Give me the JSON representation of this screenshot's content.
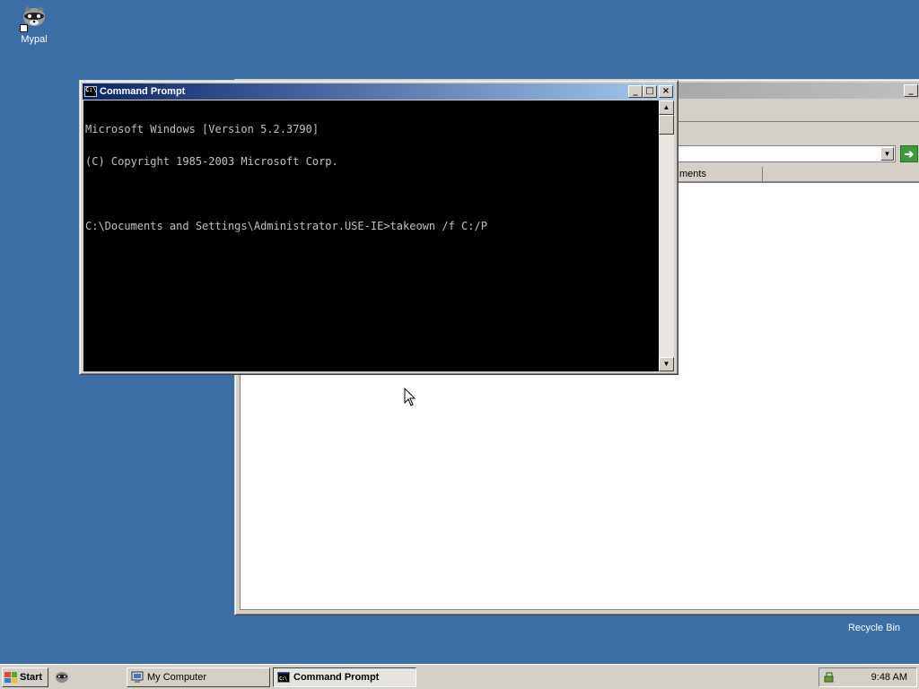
{
  "desktop": {
    "icons": [
      {
        "label": "Mypal",
        "icon": "mypal-raccoon-icon"
      },
      {
        "label": "Recycle Bin",
        "icon": "recycle-bin-icon"
      }
    ]
  },
  "explorer_window": {
    "column_header_partial": "ments",
    "go_icon": "go-arrow-icon"
  },
  "cmd_window": {
    "title": "Command Prompt",
    "lines": [
      "Microsoft Windows [Version 5.2.3790]",
      "(C) Copyright 1985-2003 Microsoft Corp.",
      "",
      "C:\\Documents and Settings\\Administrator.USE-IE>takeown /f C:/P"
    ],
    "buttons": {
      "minimize": "_",
      "maximize": "□",
      "close": "×"
    }
  },
  "taskbar": {
    "start_label": "Start",
    "tasks": [
      {
        "label": "My Computer",
        "icon": "my-computer-icon",
        "active": false
      },
      {
        "label": "Command Prompt",
        "icon": "cmd-icon",
        "active": true
      }
    ],
    "clock": "9:48 AM"
  },
  "colors": {
    "desktop": "#3a6ea5",
    "title_active_start": "#0a246a",
    "title_active_end": "#a6caf0",
    "console_bg": "#000000",
    "console_fg": "#c0c0c0"
  }
}
